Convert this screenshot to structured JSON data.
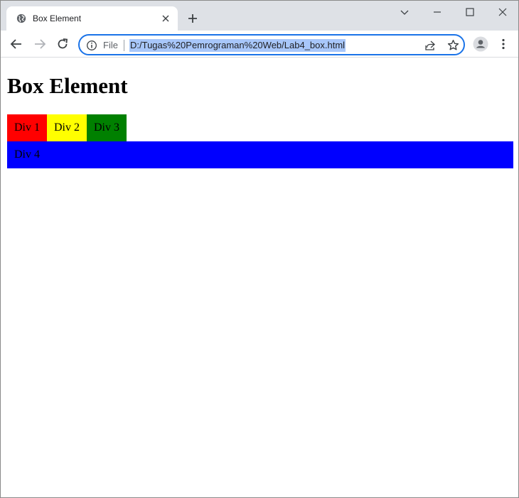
{
  "browser": {
    "tab_title": "Box Element",
    "address": {
      "scheme_label": "File",
      "url": "D:/Tugas%20Pemrograman%20Web/Lab4_box.html"
    }
  },
  "page": {
    "heading": "Box Element",
    "boxes": [
      {
        "label": "Div 1",
        "color": "#ff0000"
      },
      {
        "label": "Div 2",
        "color": "#ffff00"
      },
      {
        "label": "Div 3",
        "color": "#008000"
      },
      {
        "label": "Div 4",
        "color": "#0000ff"
      }
    ]
  },
  "icons": {
    "favicon": "globe-icon",
    "tab_close": "close-icon",
    "new_tab": "plus-icon",
    "back": "back-arrow-icon",
    "forward": "forward-arrow-icon",
    "reload": "reload-icon",
    "site_info": "info-icon",
    "share": "share-icon",
    "bookmark": "star-icon",
    "profile": "profile-icon",
    "menu": "kebab-menu-icon",
    "tab_search": "chevron-down-icon",
    "minimize": "minimize-icon",
    "maximize": "maximize-icon",
    "close_window": "close-window-icon"
  }
}
